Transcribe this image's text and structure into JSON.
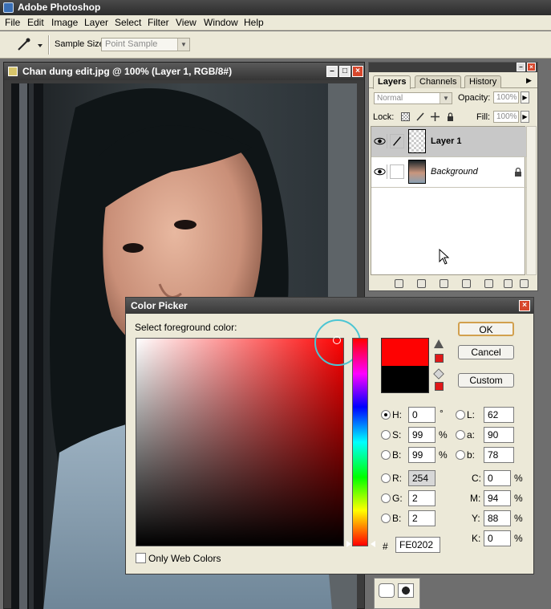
{
  "app": {
    "title": "Adobe Photoshop"
  },
  "menu": [
    "File",
    "Edit",
    "Image",
    "Layer",
    "Select",
    "Filter",
    "View",
    "Window",
    "Help"
  ],
  "options": {
    "sample_size_label": "Sample Size:",
    "sample_size_value": "Point Sample"
  },
  "document": {
    "title": "Chan dung edit.jpg @ 100% (Layer 1, RGB/8#)"
  },
  "layers_panel": {
    "tabs": [
      "Layers",
      "Channels",
      "History"
    ],
    "active_tab": "Layers",
    "blend_mode": "Normal",
    "opacity_label": "Opacity:",
    "opacity_value": "100%",
    "lock_label": "Lock:",
    "fill_label": "Fill:",
    "fill_value": "100%",
    "layers": [
      {
        "name": "Layer 1",
        "selected": true
      },
      {
        "name": "Background",
        "selected": false,
        "locked": true
      }
    ]
  },
  "color_picker": {
    "title": "Color Picker",
    "prompt": "Select foreground color:",
    "buttons": {
      "ok": "OK",
      "cancel": "Cancel",
      "custom": "Custom"
    },
    "new_color": "#fe0202",
    "current_color": "#000000",
    "hsb": [
      {
        "label": "H:",
        "value": "0",
        "unit": "°",
        "selected": true
      },
      {
        "label": "S:",
        "value": "99",
        "unit": "%",
        "selected": false
      },
      {
        "label": "B:",
        "value": "99",
        "unit": "%",
        "selected": false
      }
    ],
    "rgb": [
      {
        "label": "R:",
        "value": "254"
      },
      {
        "label": "G:",
        "value": "2"
      },
      {
        "label": "B:",
        "value": "2"
      }
    ],
    "lab": [
      {
        "label": "L:",
        "value": "62"
      },
      {
        "label": "a:",
        "value": "90"
      },
      {
        "label": "b:",
        "value": "78"
      }
    ],
    "cmyk": [
      {
        "label": "C:",
        "value": "0",
        "unit": "%"
      },
      {
        "label": "M:",
        "value": "94",
        "unit": "%"
      },
      {
        "label": "Y:",
        "value": "88",
        "unit": "%"
      },
      {
        "label": "K:",
        "value": "0",
        "unit": "%"
      }
    ],
    "hex_label": "#",
    "hex_value": "FE0202",
    "web_colors_label": "Only Web Colors"
  }
}
